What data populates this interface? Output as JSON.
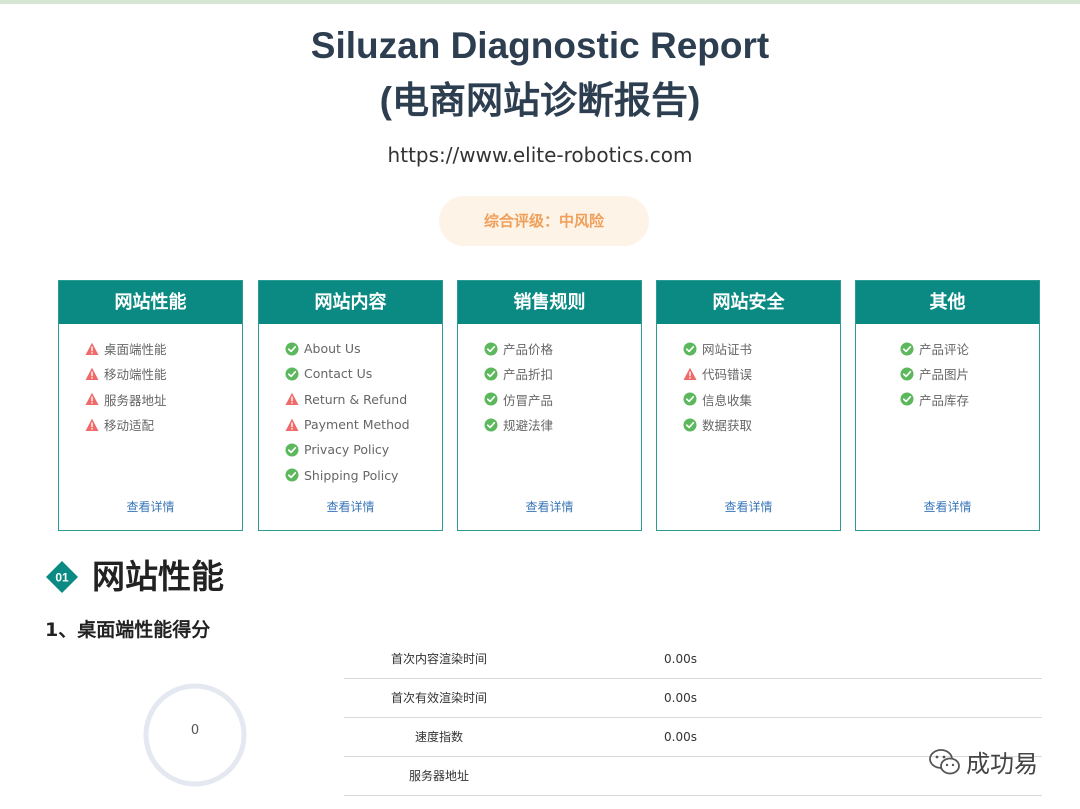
{
  "report": {
    "title_line1": "Siluzan Diagnostic Report",
    "title_line2": "(电商网站诊断报告)",
    "url": "https://www.elite-robotics.com",
    "rating_label": "综合评级：中风险"
  },
  "colors": {
    "accent": "#0a8a82",
    "ok": "#5cb85c",
    "warn": "#f06a6a",
    "rating_text": "#f0a05a",
    "rating_bg": "#fdf3e7",
    "link": "#3a77b8"
  },
  "cards": [
    {
      "title": "网站性能",
      "detail_label": "查看详情",
      "items": [
        {
          "label": "桌面端性能",
          "status": "warn",
          "icon": "warning-icon"
        },
        {
          "label": "移动端性能",
          "status": "warn",
          "icon": "warning-icon"
        },
        {
          "label": "服务器地址",
          "status": "warn",
          "icon": "warning-icon"
        },
        {
          "label": "移动适配",
          "status": "warn",
          "icon": "warning-icon"
        }
      ]
    },
    {
      "title": "网站内容",
      "detail_label": "查看详情",
      "items": [
        {
          "label": "About Us",
          "status": "ok",
          "icon": "check-icon"
        },
        {
          "label": "Contact Us",
          "status": "ok",
          "icon": "check-icon"
        },
        {
          "label": "Return & Refund",
          "status": "warn",
          "icon": "warning-icon"
        },
        {
          "label": "Payment Method",
          "status": "warn",
          "icon": "warning-icon"
        },
        {
          "label": "Privacy Policy",
          "status": "ok",
          "icon": "check-icon"
        },
        {
          "label": "Shipping Policy",
          "status": "ok",
          "icon": "check-icon"
        }
      ]
    },
    {
      "title": "销售规则",
      "detail_label": "查看详情",
      "items": [
        {
          "label": "产品价格",
          "status": "ok",
          "icon": "check-icon"
        },
        {
          "label": "产品折扣",
          "status": "ok",
          "icon": "check-icon"
        },
        {
          "label": "仿冒产品",
          "status": "ok",
          "icon": "check-icon"
        },
        {
          "label": "规避法律",
          "status": "ok",
          "icon": "check-icon"
        }
      ]
    },
    {
      "title": "网站安全",
      "detail_label": "查看详情",
      "items": [
        {
          "label": "网站证书",
          "status": "ok",
          "icon": "check-icon"
        },
        {
          "label": "代码错误",
          "status": "warn",
          "icon": "warning-icon"
        },
        {
          "label": "信息收集",
          "status": "ok",
          "icon": "check-icon"
        },
        {
          "label": "数据获取",
          "status": "ok",
          "icon": "check-icon"
        }
      ]
    },
    {
      "title": "其他",
      "detail_label": "查看详情",
      "items": [
        {
          "label": "产品评论",
          "status": "ok",
          "icon": "check-icon"
        },
        {
          "label": "产品图片",
          "status": "ok",
          "icon": "check-icon"
        },
        {
          "label": "产品库存",
          "status": "ok",
          "icon": "check-icon"
        }
      ]
    }
  ],
  "section": {
    "number": "01",
    "title": "网站性能",
    "subtitle": "1、桌面端性能得分",
    "score": "0",
    "metrics": [
      {
        "label": "首次内容渲染时间",
        "value": "0.00s"
      },
      {
        "label": "首次有效渲染时间",
        "value": "0.00s"
      },
      {
        "label": "速度指数",
        "value": "0.00s"
      },
      {
        "label": "服务器地址",
        "value": ""
      }
    ]
  },
  "watermark": {
    "text": "成功易",
    "icon": "wechat-icon"
  }
}
